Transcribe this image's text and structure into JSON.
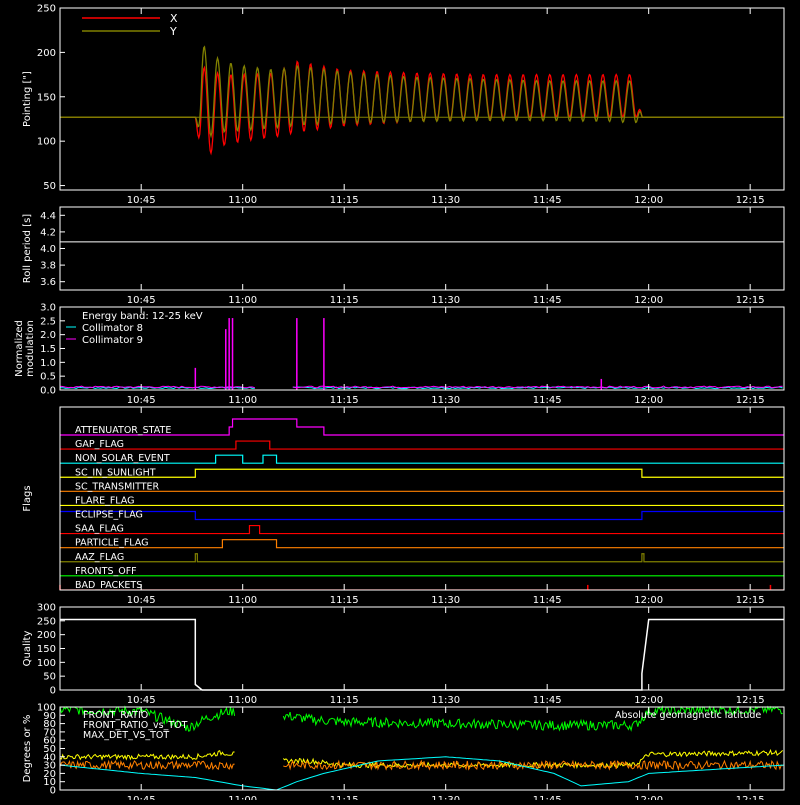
{
  "colors": {
    "x": "#ff0000",
    "y": "#808000",
    "white": "#ffffff",
    "cyan": "#00ffff",
    "magenta": "#ff00ff",
    "red": "#ff0000",
    "orange": "#ff8000",
    "yellow": "#ffff00",
    "green": "#00ff00",
    "blue": "#0000ff",
    "olive": "#808000"
  },
  "time_ticks": [
    "10:45",
    "11:00",
    "11:15",
    "11:30",
    "11:45",
    "12:00",
    "12:15"
  ],
  "chart_data": [
    {
      "id": "pointing",
      "type": "line",
      "ylabel": "Pointing [\"]",
      "ylim": [
        45,
        250
      ],
      "yticks": [
        "50",
        "100",
        "150",
        "200",
        "250"
      ],
      "legend": [
        "X",
        "Y"
      ],
      "legend_position": "top-left",
      "series": [
        {
          "name": "X",
          "color": "#ff0000",
          "x": [
            "10:33",
            "10:53",
            "10:54",
            "10:55",
            "10:57",
            "11:00",
            "11:05",
            "11:08",
            "11:15",
            "11:25",
            "11:35",
            "11:45",
            "11:55",
            "11:58",
            "11:59",
            "12:20"
          ],
          "low": [
            127,
            127,
            75,
            85,
            95,
            100,
            105,
            110,
            117,
            122,
            125,
            127,
            127,
            127,
            127,
            127
          ],
          "high": [
            127,
            127,
            185,
            180,
            175,
            175,
            177,
            190,
            180,
            177,
            175,
            175,
            175,
            175,
            127,
            127
          ]
        },
        {
          "name": "Y",
          "color": "#808000",
          "x": [
            "10:33",
            "10:53",
            "10:54",
            "10:55",
            "10:57",
            "11:00",
            "11:05",
            "11:08",
            "11:15",
            "11:25",
            "11:35",
            "11:45",
            "11:55",
            "11:58",
            "11:59",
            "12:20"
          ],
          "low": [
            127,
            127,
            100,
            105,
            110,
            112,
            115,
            118,
            120,
            122,
            123,
            123,
            122,
            120,
            127,
            127
          ],
          "high": [
            127,
            127,
            210,
            200,
            190,
            185,
            180,
            185,
            178,
            172,
            170,
            168,
            168,
            168,
            127,
            127
          ]
        }
      ]
    },
    {
      "id": "roll",
      "type": "line",
      "ylabel": "Roll period [s]",
      "ylim": [
        3.5,
        4.5
      ],
      "yticks": [
        "3.6",
        "3.8",
        "4.0",
        "4.2",
        "4.4"
      ],
      "series": [
        {
          "name": "",
          "color": "#ffffff",
          "x": [
            "10:33",
            "12:20"
          ],
          "values": [
            4.08,
            4.08
          ]
        }
      ]
    },
    {
      "id": "modulation",
      "type": "line",
      "ylabel": "Normalized modulation",
      "ylim": [
        0,
        3.0
      ],
      "yticks": [
        "0.0",
        "0.5",
        "1.0",
        "1.5",
        "2.0",
        "2.5",
        "3.0"
      ],
      "legend": [
        "Energy band: 12-25 keV",
        "Collimator 8",
        "Collimator 9"
      ],
      "legend_position": "top-left",
      "gaps": [
        [
          "11:02",
          "11:07"
        ]
      ],
      "series": [
        {
          "name": "Collimator 8",
          "color": "#00ffff",
          "baseline": 0.05
        },
        {
          "name": "Collimator 9",
          "color": "#ff00ff",
          "baseline": 0.08,
          "spikes": [
            {
              "x": "10:53",
              "y": 0.8
            },
            {
              "x": "10:57.5",
              "y": 2.2
            },
            {
              "x": "10:58",
              "y": 2.6
            },
            {
              "x": "10:58.5",
              "y": 2.6
            },
            {
              "x": "11:08",
              "y": 2.6
            },
            {
              "x": "11:12",
              "y": 2.6
            },
            {
              "x": "11:53",
              "y": 0.4
            }
          ]
        }
      ]
    },
    {
      "id": "flags",
      "type": "line",
      "ylabel": "Flags",
      "flags": [
        {
          "name": "ATTENUATOR_STATE",
          "color": "#ff00ff",
          "steps": [
            [
              "10:33",
              0
            ],
            [
              "10:58",
              1
            ],
            [
              "10:58.5",
              2
            ],
            [
              "11:08",
              1
            ],
            [
              "11:12",
              0
            ],
            [
              "12:20",
              0
            ]
          ]
        },
        {
          "name": "GAP_FLAG",
          "color": "#ff0000",
          "steps": [
            [
              "10:33",
              0
            ],
            [
              "10:59",
              1
            ],
            [
              "11:04",
              0
            ],
            [
              "12:20",
              0
            ]
          ]
        },
        {
          "name": "NON_SOLAR_EVENT",
          "color": "#00ffff",
          "steps": [
            [
              "10:33",
              0
            ],
            [
              "10:56",
              1
            ],
            [
              "11:00",
              0
            ],
            [
              "11:03",
              1
            ],
            [
              "11:05",
              0
            ],
            [
              "12:20",
              0
            ]
          ]
        },
        {
          "name": "SC_IN_SUNLIGHT",
          "color": "#ffff00",
          "steps": [
            [
              "10:33",
              0
            ],
            [
              "10:53",
              1
            ],
            [
              "11:59",
              0
            ],
            [
              "12:20",
              0
            ]
          ]
        },
        {
          "name": "SC_TRANSMITTER",
          "color": "#ff8000",
          "steps": [
            [
              "10:33",
              0
            ],
            [
              "12:20",
              0
            ]
          ]
        },
        {
          "name": "FLARE_FLAG",
          "color": "#ffff00",
          "steps": [
            [
              "10:33",
              0
            ],
            [
              "12:20",
              0
            ]
          ]
        },
        {
          "name": "ECLIPSE_FLAG",
          "color": "#0000ff",
          "steps": [
            [
              "10:33",
              1
            ],
            [
              "10:53",
              0
            ],
            [
              "11:59",
              1
            ],
            [
              "12:20",
              1
            ]
          ]
        },
        {
          "name": "SAA_FLAG",
          "color": "#ff0000",
          "steps": [
            [
              "10:33",
              0
            ],
            [
              "11:01",
              1
            ],
            [
              "11:02.5",
              0
            ],
            [
              "12:20",
              0
            ]
          ]
        },
        {
          "name": "PARTICLE_FLAG",
          "color": "#ff8000",
          "steps": [
            [
              "10:33",
              0
            ],
            [
              "10:57",
              1
            ],
            [
              "11:05",
              0
            ],
            [
              "12:20",
              0
            ]
          ]
        },
        {
          "name": "AAZ_FLAG",
          "color": "#808000",
          "steps": [
            [
              "10:33",
              0
            ],
            [
              "10:53",
              1
            ],
            [
              "10:53.3",
              0
            ],
            [
              "11:59",
              1
            ],
            [
              "11:59.3",
              0
            ],
            [
              "12:20",
              0
            ]
          ]
        },
        {
          "name": "FRONTS_OFF",
          "color": "#00ff00",
          "steps": [
            [
              "10:33",
              0
            ],
            [
              "12:20",
              0
            ]
          ]
        },
        {
          "name": "BAD_PACKETS",
          "color": "#ff0000",
          "steps": [
            [
              "10:33",
              0
            ],
            [
              "12:20",
              0
            ]
          ],
          "ticks": [
            "10:33",
            "11:51",
            "12:18"
          ]
        }
      ]
    },
    {
      "id": "quality",
      "type": "line",
      "ylabel": "Quality",
      "ylim": [
        0,
        300
      ],
      "yticks": [
        "0",
        "50",
        "100",
        "150",
        "200",
        "250",
        "300"
      ],
      "series": [
        {
          "name": "",
          "color": "#ffffff",
          "x": [
            "10:33",
            "10:53",
            "10:53",
            "10:54",
            "11:59",
            "11:59",
            "12:00",
            "12:20"
          ],
          "values": [
            255,
            255,
            20,
            0,
            0,
            60,
            255,
            255
          ]
        }
      ]
    },
    {
      "id": "geo",
      "type": "line",
      "ylabel": "Degrees or %",
      "ylim": [
        0,
        100
      ],
      "yticks": [
        "0",
        "10",
        "20",
        "30",
        "40",
        "50",
        "60",
        "70",
        "80",
        "90",
        "100"
      ],
      "legend": [
        "FRONT_RATIO",
        "FRONT_RATIO_vs_TOT",
        "MAX_DET_VS_TOT",
        "Absolute geomagnetic latitude"
      ],
      "legend_position": "top",
      "gaps": [
        [
          "10:59",
          "11:06"
        ]
      ],
      "series": [
        {
          "name": "FRONT_RATIO",
          "color": "#00ff00",
          "x": [
            "10:33",
            "10:45",
            "10:52",
            "10:55",
            "10:58",
            "11:06",
            "11:10",
            "11:15",
            "11:30",
            "11:45",
            "11:58",
            "12:00",
            "12:15",
            "12:20"
          ],
          "values": [
            97,
            95,
            75,
            88,
            95,
            90,
            85,
            82,
            80,
            78,
            78,
            95,
            97,
            97
          ]
        },
        {
          "name": "FRONT_RATIO_vs_TOT",
          "color": "#ffff00",
          "x": [
            "10:33",
            "10:53",
            "10:57",
            "11:06",
            "11:10",
            "11:15",
            "11:30",
            "11:58",
            "12:00",
            "12:20"
          ],
          "values": [
            40,
            40,
            45,
            35,
            35,
            30,
            30,
            30,
            43,
            45
          ]
        },
        {
          "name": "MAX_DET_VS_TOT",
          "color": "#ff8000",
          "x": [
            "10:33",
            "12:20"
          ],
          "values": [
            30,
            30
          ]
        },
        {
          "name": "Absolute geomagnetic latitude",
          "color": "#00ffff",
          "x": [
            "10:33",
            "10:45",
            "10:53",
            "11:00",
            "11:05",
            "11:08",
            "11:12",
            "11:20",
            "11:30",
            "11:38",
            "11:46",
            "11:50",
            "11:57",
            "12:00",
            "12:20"
          ],
          "values": [
            30,
            20,
            15,
            5,
            0,
            10,
            20,
            35,
            40,
            35,
            20,
            5,
            10,
            20,
            30
          ]
        }
      ]
    }
  ]
}
